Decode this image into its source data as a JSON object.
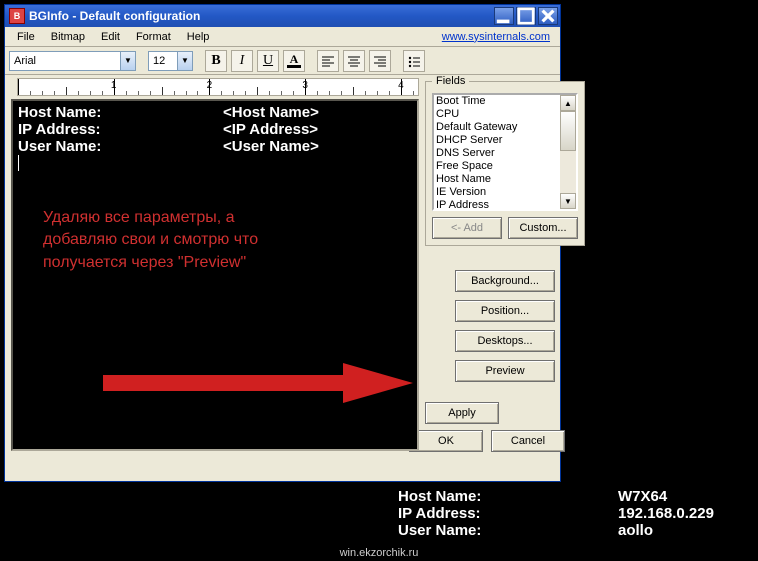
{
  "titlebar": {
    "title": "BGInfo - Default configuration"
  },
  "menu": {
    "items": [
      "File",
      "Bitmap",
      "Edit",
      "Format",
      "Help"
    ],
    "link": "www.sysinternals.com"
  },
  "toolbar": {
    "font_name": "Arial",
    "font_size": "12",
    "bold": "B",
    "italic": "I",
    "underline": "U",
    "color": "A"
  },
  "ruler": {
    "marks": [
      "1",
      "2",
      "3",
      "4"
    ]
  },
  "editor": {
    "rows": [
      {
        "label": "Host Name:",
        "value": "<Host Name>"
      },
      {
        "label": "IP Address:",
        "value": "<IP Address>"
      },
      {
        "label": "User Name:",
        "value": "<User Name>"
      }
    ],
    "annotation": "Удаляю все параметры, а добавляю свои и смотрю что получается через \"Preview\""
  },
  "fields": {
    "legend": "Fields",
    "items": [
      "Boot Time",
      "CPU",
      "Default Gateway",
      "DHCP Server",
      "DNS Server",
      "Free Space",
      "Host Name",
      "IE Version",
      "IP Address"
    ],
    "add": "<- Add",
    "custom": "Custom..."
  },
  "buttons": {
    "background": "Background...",
    "position": "Position...",
    "desktops": "Desktops...",
    "preview": "Preview",
    "apply": "Apply",
    "ok": "OK",
    "cancel": "Cancel"
  },
  "desktop": {
    "rows": [
      {
        "label": "Host Name:",
        "value": "W7X64"
      },
      {
        "label": "IP Address:",
        "value": "192.168.0.229"
      },
      {
        "label": "User Name:",
        "value": "aollo"
      }
    ]
  },
  "watermark": "win.ekzorchik.ru"
}
